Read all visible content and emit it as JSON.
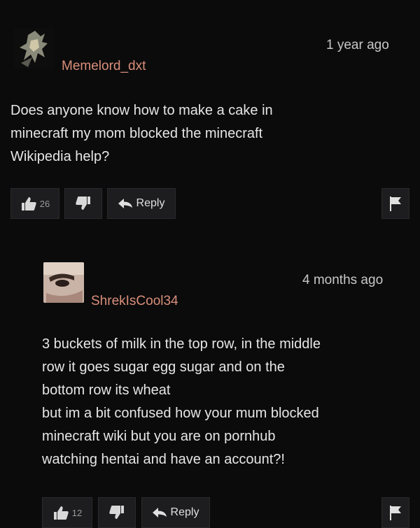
{
  "comments": [
    {
      "username": "Memelord_dxt",
      "timestamp": "1 year ago",
      "avatar_icon": "anime-character-avatar",
      "lines": [
        "Does anyone know how to make a cake in",
        "minecraft my mom blocked the minecraft",
        "Wikipedia help?"
      ],
      "likes": "26",
      "reply_label": "Reply"
    },
    {
      "username": "ShrekIsCool34",
      "timestamp": "4 months ago",
      "avatar_icon": "face-closeup-avatar",
      "lines": [
        "3 buckets of milk in the top row, in the middle",
        "row it goes sugar egg sugar and on the",
        "bottom row its wheat",
        "but im a bit confused how your mum blocked",
        "minecraft wiki but you are on pornhub",
        "watching hentai and have an account?!"
      ],
      "likes": "12",
      "reply_label": "Reply"
    }
  ],
  "colors": {
    "background": "#0b0b0c",
    "username": "#d98f7a",
    "text": "#e6e6e6",
    "button_bg": "#1d1d1f"
  }
}
